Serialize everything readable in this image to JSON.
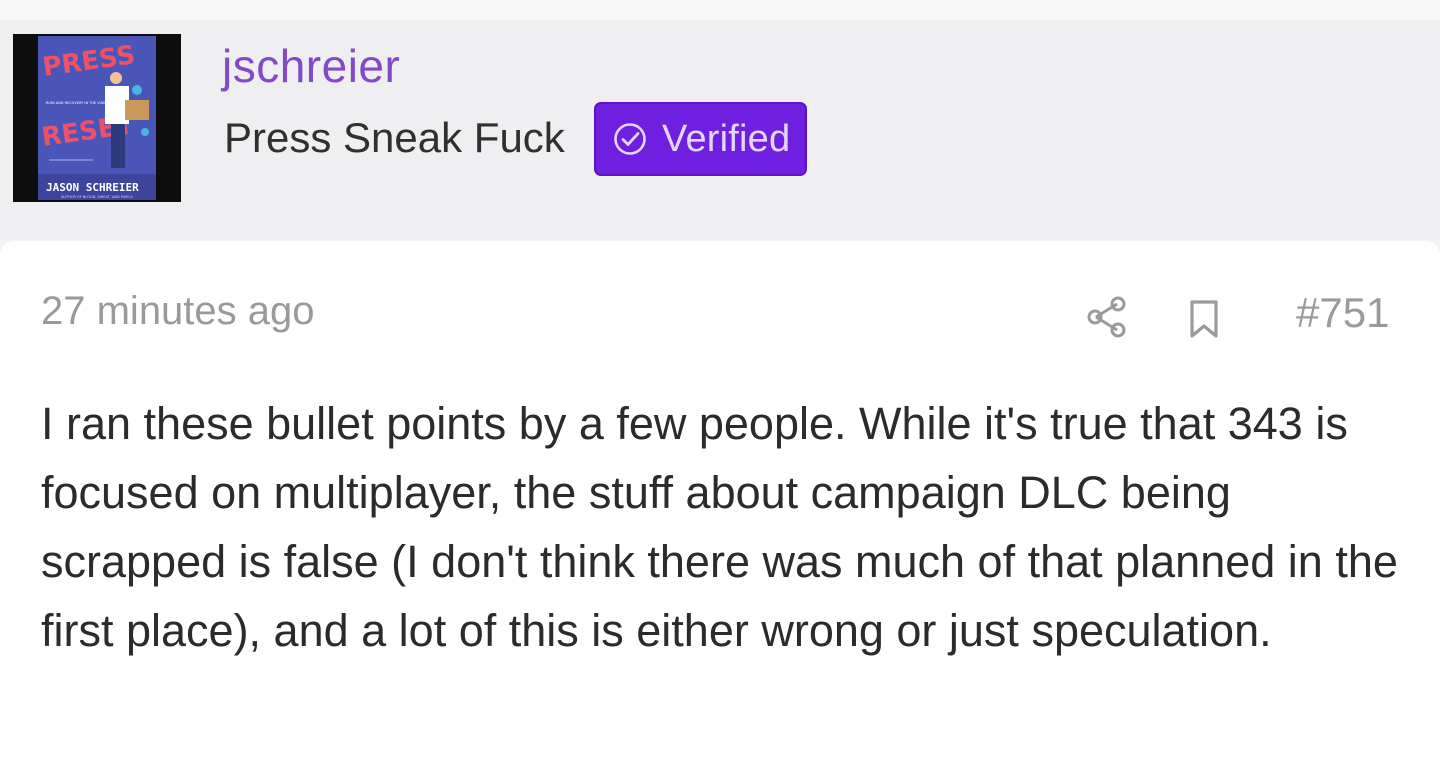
{
  "profile": {
    "avatar_cover": {
      "title_line1": "PRESS",
      "title_line2": "RESET",
      "subtitle": "RUIN AND RECOVERY IN THE VIDEO GAME INDUSTRY",
      "author": "JASON SCHREIER",
      "tagline": "AUTHOR OF BLOOD, SWEAT, AND PIXELS"
    },
    "username": "jschreier",
    "user_title": "Press Sneak Fuck",
    "badge": {
      "label": "Verified",
      "icon": "check-circle-icon",
      "color": "#6f1fe0"
    }
  },
  "post": {
    "timestamp": "27 minutes ago",
    "share_icon": "share-icon",
    "bookmark_icon": "bookmark-icon",
    "post_number": "#751",
    "body": "I ran these bullet points by a few people. While it's true that 343 is focused on multiplayer, the stuff about campaign DLC being scrapped is false (I don't think there was much of that planned in the first place), and a lot of this is either wrong or just speculation."
  },
  "colors": {
    "username": "#8249c9",
    "muted_text": "#9a9a9a",
    "body_text": "#2b2b2b",
    "header_bg": "#efeef0"
  }
}
